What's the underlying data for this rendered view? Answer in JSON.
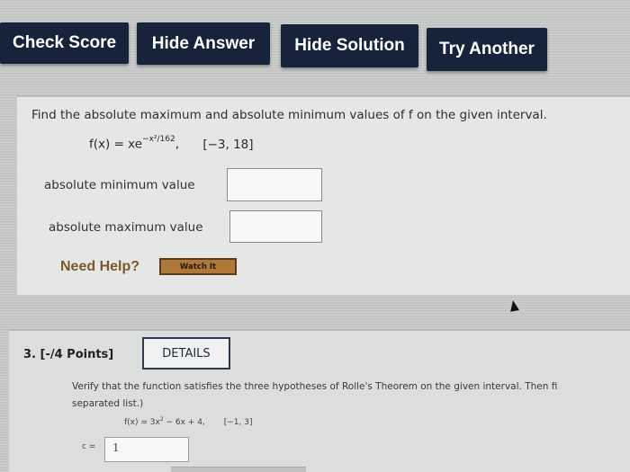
{
  "toolbar": {
    "check_score": "Check Score",
    "hide_answer": "Hide Answer",
    "hide_solution": "Hide Solution",
    "try_another": "Try Another",
    "button_color": "#16233b"
  },
  "question": {
    "prompt": "Find the absolute maximum and absolute minimum values of f on the given interval.",
    "function_lhs": "f(x) = xe",
    "function_exp": "−x²/162",
    "function_comma": ",",
    "interval": "[−3, 18]",
    "min_label": "absolute minimum value",
    "min_value": "",
    "max_label": "absolute maximum value",
    "max_value": "",
    "need_help": "Need Help?",
    "watch_it": "Watch It"
  },
  "question3": {
    "header": "3.  [-/4 Points]",
    "details": "DETAILS",
    "text_line1": "Verify that the function satisfies the three hypotheses of Rolle's Theorem on the given interval. Then fi",
    "text_line2": "separated list.)",
    "function_lhs": "f(x) = 3x",
    "function_exp": "2",
    "function_rest": " − 6x + 4,",
    "interval": "[−1, 3]",
    "c_label": "c =",
    "c_value": "1"
  }
}
